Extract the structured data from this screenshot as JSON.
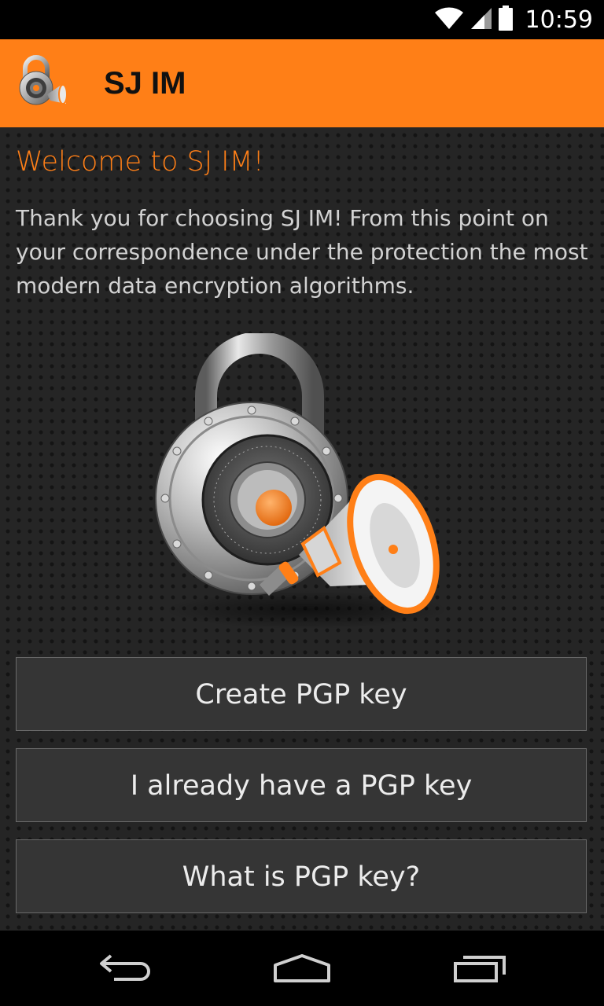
{
  "status_bar": {
    "time": "10:59",
    "icons": [
      "wifi-icon",
      "cell-signal-icon",
      "battery-icon"
    ]
  },
  "app_bar": {
    "title": "SJ IM",
    "logo_icon": "padlock-megaphone-icon"
  },
  "main": {
    "welcome_title": "Welcome to SJ IM!",
    "welcome_text": "Thank you for choosing SJ IM! From this point on your correspondence under the protection the most modern data encryption algorithms.",
    "hero_image": "padlock-megaphone-icon",
    "buttons": [
      {
        "label": "Create PGP key"
      },
      {
        "label": "I already have a PGP key"
      },
      {
        "label": "What is PGP key?"
      }
    ]
  },
  "nav_bar": {
    "icons": [
      "back-icon",
      "home-icon",
      "recent-apps-icon"
    ]
  },
  "colors": {
    "accent": "#ff7f17",
    "background": "#252525",
    "button_bg": "#353535",
    "button_border": "#6a6a6a"
  }
}
